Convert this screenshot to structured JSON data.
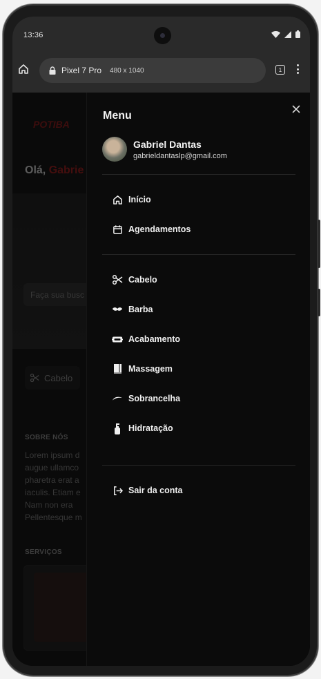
{
  "status": {
    "time": "13:36"
  },
  "browser": {
    "url": "Pixel 7 Pro",
    "dims": "480 x 1040",
    "tab_count": "1"
  },
  "page": {
    "logo_text": "POTIBA",
    "greeting_prefix": "Olá,",
    "greeting_name": "Gabrie",
    "search_placeholder": "Faça sua busc",
    "chip_label": "Cabelo",
    "about_heading": "SOBRE NÓS",
    "about_text": "Lorem ipsum d\naugue ullamco\npharetra erat a\niaculis. Etiam e\nNam non era\nPellentesque m",
    "services_heading": "SERVIÇOS"
  },
  "menu": {
    "title": "Menu",
    "user": {
      "name": "Gabriel Dantas",
      "email": "gabrieldantaslp@gmail.com"
    },
    "primary": [
      {
        "label": "Início",
        "icon": "home-icon"
      },
      {
        "label": "Agendamentos",
        "icon": "calendar-icon"
      }
    ],
    "services": [
      {
        "label": "Cabelo",
        "icon": "scissors-icon"
      },
      {
        "label": "Barba",
        "icon": "mustache-icon"
      },
      {
        "label": "Acabamento",
        "icon": "razor-icon"
      },
      {
        "label": "Massagem",
        "icon": "towel-icon"
      },
      {
        "label": "Sobrancelha",
        "icon": "eyebrow-icon"
      },
      {
        "label": "Hidratação",
        "icon": "lotion-bottle-icon"
      }
    ],
    "logout": {
      "label": "Sair da conta",
      "icon": "logout-icon"
    }
  },
  "colors": {
    "accent": "#c0392b",
    "drawer_bg": "#0b0b0b",
    "divider": "#262626"
  }
}
